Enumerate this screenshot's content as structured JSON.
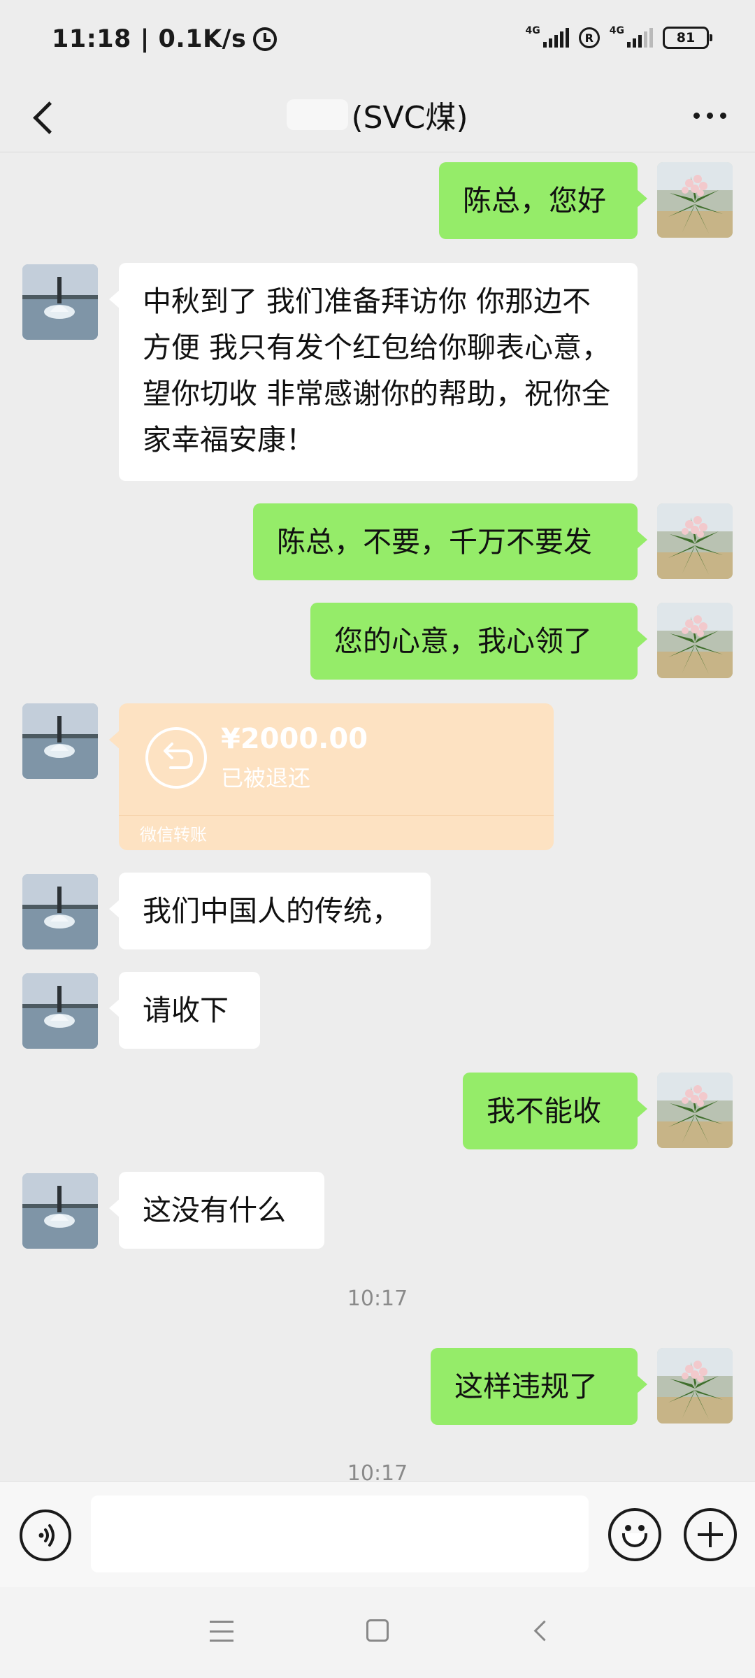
{
  "status_bar": {
    "time_speed": "11:18 | 0.1K/s",
    "net1": "4G",
    "net2": "4G",
    "reg": "R",
    "battery": "81"
  },
  "header": {
    "title": "(SVC煤)"
  },
  "messages": [
    {
      "side": "right",
      "text": "陈总，您好"
    },
    {
      "side": "left",
      "text": "中秋到了 我们准备拜访你 你那边不方便 我只有发个红包给你聊表心意，望你切收 非常感谢你的帮助，祝你全家幸福安康！"
    },
    {
      "side": "right",
      "text": "陈总，不要，千万不要发"
    },
    {
      "side": "right",
      "text": "您的心意，我心领了"
    },
    {
      "side": "left",
      "type": "transfer"
    },
    {
      "side": "left",
      "text": "我们中国人的传统，"
    },
    {
      "side": "left",
      "text": "请收下"
    },
    {
      "side": "right",
      "text": "我不能收"
    },
    {
      "side": "left",
      "text": "这没有什么"
    },
    {
      "side": "right",
      "text": "这样违规了"
    }
  ],
  "transfer": {
    "amount": "¥2000.00",
    "status": "已被退还",
    "label": "微信转账"
  },
  "timestamps": [
    "10:17",
    "10:17"
  ],
  "colors": {
    "background": "#ededed",
    "sent_bubble": "#95ec69",
    "received_bubble": "#ffffff",
    "transfer_returned": "#fde2c2"
  },
  "icons": {
    "back": "chevron-left-icon",
    "more": "more-dots-icon",
    "voice": "voice-icon",
    "emoji": "emoji-icon",
    "plus": "plus-icon"
  }
}
